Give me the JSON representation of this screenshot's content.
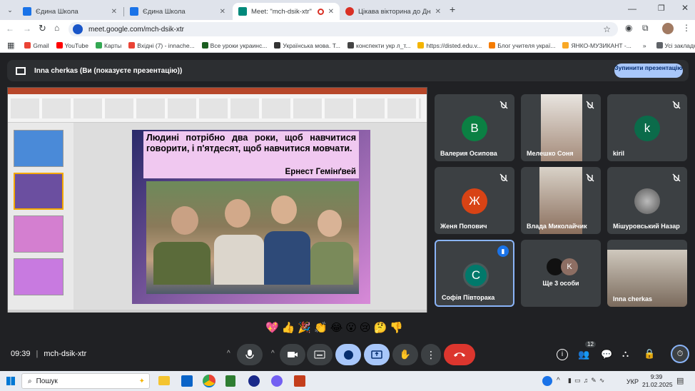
{
  "tabs": [
    {
      "title": "Єдина Школа",
      "color": "#1a73e8"
    },
    {
      "title": "Єдина Школа",
      "color": "#1a73e8"
    },
    {
      "title": "Meet: \"mch-dsik-xtr\"",
      "color": "#00897b"
    },
    {
      "title": "Цікава вікторина до Дня рідн",
      "color": "#d93025"
    }
  ],
  "address": "meet.google.com/mch-dsik-xtr",
  "bookmarks": [
    "Gmail",
    "YouTube",
    "Карты",
    "Вхідні (7) - innache...",
    "Все уроки украинс...",
    "Українська мова. Т...",
    "конспекти укр л_т...",
    "https://disted.edu.v...",
    "Блог учителя украї...",
    "ЯНКО-МУЗИКАНТ -..."
  ],
  "bookmarks_all": "Усі закладки",
  "presenting_label": "Inna cherkas (Ви (показуєте презентацію))",
  "stop_label": "Зупинити презентацію",
  "slide": {
    "quote": "Людині потрібно два роки, щоб навчитися говорити, і п'ятдесят, щоб навчитися мовчати.",
    "author": "Ернест Гемінґвей"
  },
  "participants": [
    {
      "name": "Валерия Осипова",
      "initial": "В",
      "color": "#0b8043"
    },
    {
      "name": "Мелешко Соня",
      "initial": "",
      "color": "#7a6a5a"
    },
    {
      "name": "kiril",
      "initial": "k",
      "color": "#0b6b4a"
    },
    {
      "name": "Женя Попович",
      "initial": "Ж",
      "color": "#d84315"
    },
    {
      "name": "Влада Миколайчик",
      "initial": "",
      "color": "#8a6e5c"
    },
    {
      "name": "Мішуровський Назар",
      "initial": "",
      "color": "#888"
    },
    {
      "name": "Софія Півторака",
      "initial": "С",
      "color": "#00796b"
    },
    {
      "name": "Ще 3 особи",
      "initial": "K",
      "color": "#8d6e63"
    },
    {
      "name": "Inna cherkas",
      "initial": "",
      "color": "#a08070"
    }
  ],
  "time": "09:39",
  "meeting_code": "mch-dsik-xtr",
  "people_count": "12",
  "taskbar_search": "Пошук",
  "tray": {
    "lang": "УКР",
    "time": "9:39",
    "date": "21.02.2025"
  }
}
